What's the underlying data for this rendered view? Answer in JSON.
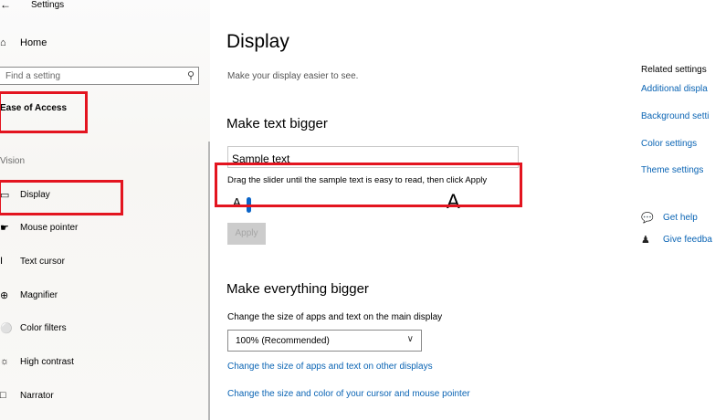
{
  "window": {
    "title": "Settings"
  },
  "sidebar": {
    "home_label": "Home",
    "search_placeholder": "Find a setting",
    "section_title": "Ease of Access",
    "group_label": "Vision",
    "items": [
      {
        "label": "Display",
        "icon": "monitor-icon"
      },
      {
        "label": "Mouse pointer",
        "icon": "mouse-pointer-icon"
      },
      {
        "label": "Text cursor",
        "icon": "text-cursor-icon"
      },
      {
        "label": "Magnifier",
        "icon": "magnifier-icon"
      },
      {
        "label": "Color filters",
        "icon": "color-filters-icon"
      },
      {
        "label": "High contrast",
        "icon": "high-contrast-icon"
      },
      {
        "label": "Narrator",
        "icon": "narrator-icon"
      }
    ]
  },
  "main": {
    "title": "Display",
    "subtitle": "Make your display easier to see.",
    "text_bigger": {
      "heading": "Make text bigger",
      "sample_text": "Sample text",
      "instruction": "Drag the slider until the sample text is easy to read, then click Apply",
      "small_a": "A",
      "large_a": "A",
      "slider_value": 0,
      "apply_label": "Apply"
    },
    "everything_bigger": {
      "heading": "Make everything bigger",
      "size_label": "Change the size of apps and text on the main display",
      "size_value": "100% (Recommended)",
      "link_other_displays": "Change the size of apps and text on other displays",
      "link_cursor": "Change the size and color of your cursor and mouse pointer"
    }
  },
  "related": {
    "title": "Related settings",
    "links": [
      "Additional displa",
      "Background setti",
      "Color settings",
      "Theme settings"
    ],
    "get_help": "Get help",
    "give_feedback": "Give feedba"
  },
  "colors": {
    "accent": "#0a64c8",
    "highlight": "#e3141f",
    "link": "#0a64b4"
  }
}
